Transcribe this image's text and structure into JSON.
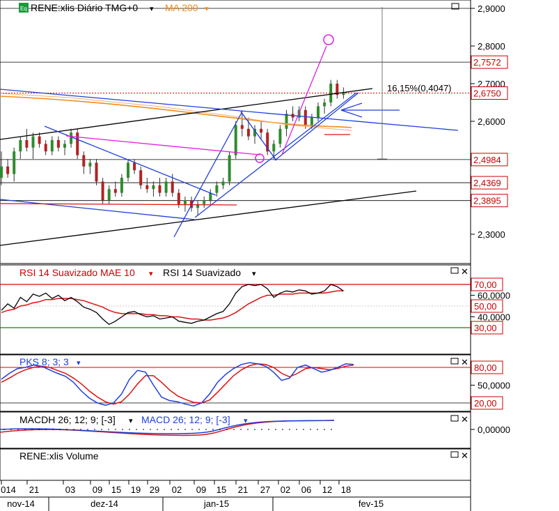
{
  "chart_data": [
    {
      "type": "candlestick",
      "title": "RENE:xlis Diário TMG+0",
      "overlay_label": "MA 200",
      "ylim": [
        2.22,
        2.93
      ],
      "y_ticks": [
        "2,9000",
        "2,8000",
        "2,7000",
        "2,6000",
        "2,3000"
      ],
      "price_tags": [
        {
          "text": "2,7572",
          "value": 2.7572,
          "color": "#cc0000"
        },
        {
          "text": "2,6750",
          "value": 2.675,
          "color": "#cc0000"
        },
        {
          "text": "2,4984",
          "value": 2.4984,
          "color": "#cc0000"
        },
        {
          "text": "2,4369",
          "value": 2.4369,
          "color": "#cc0000"
        },
        {
          "text": "2,3895",
          "value": 2.3895,
          "color": "#cc0000"
        }
      ],
      "annotation": "16,15%(0,4047)",
      "candles": [
        [
          2.45,
          2.52,
          2.43,
          2.48
        ],
        [
          2.48,
          2.5,
          2.45,
          2.46
        ],
        [
          2.46,
          2.53,
          2.44,
          2.52
        ],
        [
          2.52,
          2.56,
          2.5,
          2.55
        ],
        [
          2.55,
          2.58,
          2.52,
          2.53
        ],
        [
          2.53,
          2.57,
          2.5,
          2.56
        ],
        [
          2.56,
          2.57,
          2.53,
          2.54
        ],
        [
          2.54,
          2.55,
          2.51,
          2.52
        ],
        [
          2.52,
          2.56,
          2.51,
          2.55
        ],
        [
          2.55,
          2.56,
          2.52,
          2.53
        ],
        [
          2.53,
          2.55,
          2.51,
          2.54
        ],
        [
          2.54,
          2.58,
          2.53,
          2.57
        ],
        [
          2.57,
          2.58,
          2.5,
          2.51
        ],
        [
          2.51,
          2.52,
          2.46,
          2.48
        ],
        [
          2.48,
          2.5,
          2.46,
          2.49
        ],
        [
          2.49,
          2.5,
          2.43,
          2.44
        ],
        [
          2.44,
          2.45,
          2.38,
          2.39
        ],
        [
          2.39,
          2.43,
          2.38,
          2.42
        ],
        [
          2.42,
          2.44,
          2.4,
          2.41
        ],
        [
          2.41,
          2.46,
          2.4,
          2.45
        ],
        [
          2.45,
          2.5,
          2.44,
          2.49
        ],
        [
          2.49,
          2.5,
          2.46,
          2.47
        ],
        [
          2.47,
          2.48,
          2.42,
          2.43
        ],
        [
          2.43,
          2.45,
          2.41,
          2.42
        ],
        [
          2.42,
          2.44,
          2.4,
          2.43
        ],
        [
          2.43,
          2.45,
          2.4,
          2.41
        ],
        [
          2.41,
          2.45,
          2.4,
          2.44
        ],
        [
          2.44,
          2.46,
          2.4,
          2.41
        ],
        [
          2.41,
          2.42,
          2.37,
          2.38
        ],
        [
          2.38,
          2.4,
          2.36,
          2.39
        ],
        [
          2.39,
          2.4,
          2.36,
          2.37
        ],
        [
          2.37,
          2.39,
          2.35,
          2.38
        ],
        [
          2.38,
          2.4,
          2.37,
          2.39
        ],
        [
          2.39,
          2.42,
          2.38,
          2.41
        ],
        [
          2.41,
          2.44,
          2.4,
          2.43
        ],
        [
          2.43,
          2.45,
          2.42,
          2.44
        ],
        [
          2.44,
          2.52,
          2.43,
          2.51
        ],
        [
          2.51,
          2.6,
          2.5,
          2.59
        ],
        [
          2.59,
          2.62,
          2.56,
          2.58
        ],
        [
          2.58,
          2.61,
          2.55,
          2.56
        ],
        [
          2.56,
          2.59,
          2.54,
          2.58
        ],
        [
          2.58,
          2.6,
          2.55,
          2.57
        ],
        [
          2.57,
          2.58,
          2.51,
          2.52
        ],
        [
          2.52,
          2.55,
          2.5,
          2.54
        ],
        [
          2.54,
          2.59,
          2.53,
          2.58
        ],
        [
          2.58,
          2.63,
          2.56,
          2.62
        ],
        [
          2.62,
          2.64,
          2.6,
          2.61
        ],
        [
          2.61,
          2.64,
          2.6,
          2.63
        ],
        [
          2.63,
          2.64,
          2.58,
          2.59
        ],
        [
          2.59,
          2.62,
          2.58,
          2.61
        ],
        [
          2.61,
          2.65,
          2.6,
          2.64
        ],
        [
          2.64,
          2.66,
          2.62,
          2.65
        ],
        [
          2.65,
          2.71,
          2.64,
          2.7
        ],
        [
          2.7,
          2.71,
          2.66,
          2.67
        ],
        [
          2.67,
          2.69,
          2.66,
          2.675
        ]
      ]
    },
    {
      "type": "line",
      "title": "RSI 14 Suavizado MAE 10",
      "series_names": [
        "RSI 14 Suavizado MAE 10",
        "RSI 14 Suavizado"
      ],
      "ylim": [
        25,
        75
      ],
      "y_ticks": [
        "60,0000",
        "40,0000"
      ],
      "price_tags": [
        {
          "text": "70,00",
          "value": 70
        },
        {
          "text": "50,00",
          "value": 50
        },
        {
          "text": "30,00",
          "value": 30
        }
      ],
      "rsi": [
        46,
        52,
        48,
        58,
        54,
        61,
        59,
        62,
        57,
        60,
        55,
        58,
        54,
        49,
        47,
        44,
        38,
        33,
        36,
        40,
        44,
        45,
        42,
        40,
        41,
        38,
        39,
        40,
        36,
        35,
        34,
        36,
        37,
        40,
        43,
        45,
        52,
        62,
        68,
        70,
        69,
        70,
        66,
        58,
        62,
        64,
        63,
        65,
        64,
        61,
        62,
        64,
        70,
        68,
        64
      ],
      "mae": [
        44,
        46,
        47,
        50,
        51,
        53,
        54,
        56,
        56,
        57,
        57,
        57,
        56,
        55,
        53,
        51,
        49,
        46,
        44,
        43,
        43,
        43,
        43,
        42,
        42,
        41,
        41,
        40,
        40,
        39,
        38,
        38,
        37,
        37,
        38,
        39,
        41,
        44,
        48,
        52,
        55,
        58,
        60,
        60,
        61,
        61,
        61,
        62,
        62,
        62,
        62,
        62,
        63,
        64,
        64
      ]
    },
    {
      "type": "line",
      "title": "PKS 8; 3; 3",
      "ylim": [
        10,
        92
      ],
      "y_ticks": [
        "50,0000"
      ],
      "price_tags": [
        {
          "text": "80,00",
          "value": 80
        },
        {
          "text": "20,00",
          "value": 20
        }
      ],
      "k": [
        60,
        70,
        78,
        80,
        84,
        82,
        76,
        70,
        65,
        55,
        40,
        28,
        20,
        16,
        20,
        35,
        60,
        75,
        72,
        50,
        30,
        24,
        22,
        18,
        15,
        20,
        35,
        55,
        68,
        78,
        85,
        88,
        86,
        82,
        72,
        58,
        62,
        80,
        84,
        78,
        72,
        75,
        80,
        86,
        85
      ],
      "d": [
        55,
        62,
        70,
        76,
        80,
        82,
        80,
        75,
        70,
        62,
        52,
        40,
        30,
        22,
        18,
        22,
        35,
        52,
        66,
        66,
        55,
        42,
        32,
        26,
        21,
        20,
        25,
        38,
        52,
        66,
        76,
        83,
        86,
        85,
        80,
        70,
        64,
        70,
        78,
        80,
        78,
        76,
        78,
        82,
        84
      ]
    },
    {
      "type": "line",
      "title": "MACDH 26; 12; 9; [-3]",
      "series_names": [
        "MACDH 26; 12; 9; [-3]",
        "MACD 26; 12; 9; [-3]"
      ],
      "y_ticks": [
        "0,00000"
      ]
    },
    {
      "type": "bar",
      "title": "RENE:xlis Volume"
    }
  ],
  "x_axis": {
    "day_labels": [
      "014",
      "21",
      "03",
      "09",
      "15",
      "19",
      "29",
      "02",
      "09",
      "15",
      "21",
      "27",
      "02",
      "06",
      "12",
      "18"
    ],
    "month_labels": [
      "nov-14",
      "dez-14",
      "jan-15",
      "fev-15"
    ]
  },
  "colors": {
    "up": "#2e8b2e",
    "down": "#b22222",
    "blue": "#1f3fd9",
    "red": "#dd1111",
    "magenta": "#e020e0",
    "orange": "#f08c1e",
    "black": "#000000"
  },
  "icons": [
    "eq-icon",
    "maximize-icon",
    "close-icon"
  ]
}
